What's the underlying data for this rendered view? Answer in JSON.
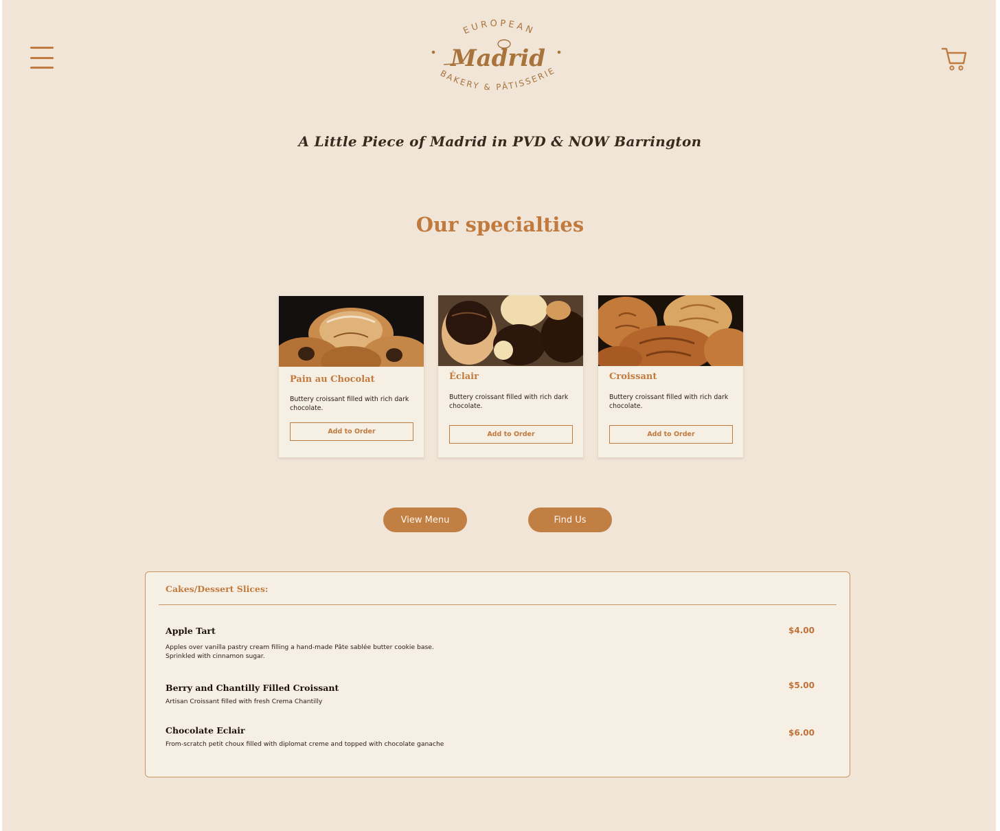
{
  "brand": {
    "top_text": "EUROPEAN",
    "script_name": "Madrid",
    "bottom_text": "BAKERY & PÂTISSERIE",
    "accent_color": "#c07a3e"
  },
  "header": {
    "menu_icon": "hamburger-menu-icon",
    "cart_icon": "shopping-cart-icon"
  },
  "hero": {
    "tagline": "A Little Piece of Madrid in PVD & NOW Barrington"
  },
  "specialties": {
    "title": "Our specialties",
    "cards": [
      {
        "name": "Pain au Chocolat",
        "description": "Buttery croissant filled with rich dark chocolate.",
        "button": "Add to Order"
      },
      {
        "name": "Éclair",
        "description": "Buttery croissant filled with rich dark chocolate.",
        "button": "Add to Order"
      },
      {
        "name": "Croissant",
        "description": "Buttery croissant filled with rich dark chocolate.",
        "button": "Add to Order"
      }
    ]
  },
  "actions": {
    "view_menu": "View Menu",
    "find_us": "Find Us"
  },
  "menu": {
    "heading": "Cakes/Dessert Slices:",
    "items": [
      {
        "name": "Apple Tart",
        "description": "Apples over vanilla pastry cream filling a hand-made Pâte sablée butter cookie base. Sprinkled with cinnamon sugar.",
        "price": "$4.00"
      },
      {
        "name": "Berry and Chantilly Filled Croissant",
        "description": "Artisan Croissant filled with fresh Crema Chantilly",
        "price": "$5.00"
      },
      {
        "name": "Chocolate Eclair",
        "description": "From-scratch petit choux filled with diplomat creme and topped with chocolate ganache",
        "price": "$6.00"
      }
    ]
  }
}
